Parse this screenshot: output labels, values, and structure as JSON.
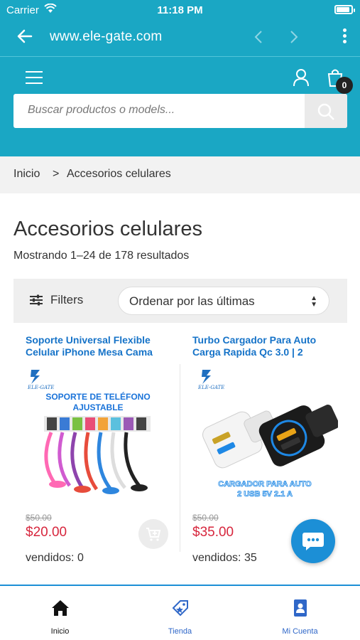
{
  "status_bar": {
    "carrier": "Carrier",
    "time": "11:18 PM"
  },
  "browser": {
    "url": "www.ele-gate.com"
  },
  "header": {
    "cart_count": "0",
    "search_placeholder": "Buscar productos o models..."
  },
  "breadcrumb": {
    "home": "Inicio",
    "separator": ">",
    "current": "Accesorios celulares"
  },
  "page": {
    "title": "Accesorios celulares",
    "result_count": "Mostrando 1–24 de 178 resultados"
  },
  "toolbar": {
    "filters_label": "Filters",
    "sort_value": "Ordenar por las últimas"
  },
  "products": [
    {
      "title": "Soporte Universal Flexible Celular iPhone Mesa Cama",
      "image_brand": "ELE-GATE",
      "image_caption": "SOPORTE DE TELÉFONO AJUSTABLE",
      "old_price": "$50.00",
      "price": "$20.00",
      "sold": "vendidos: 0"
    },
    {
      "title": "Turbo Cargador Para Auto Carga Rapida Qc 3.0 | 2",
      "image_brand": "ELE-GATE",
      "image_caption": "CARGADOR PARA AUTO 2 USB 5V 2.1 A",
      "old_price": "$50.00",
      "price": "$35.00",
      "sold": "vendidos: 35"
    }
  ],
  "tabbar": {
    "home": "Inicio",
    "shop": "Tienda",
    "account": "Mi Cuenta"
  },
  "colors": {
    "brand": "#1aa7c4",
    "link": "#1673c8",
    "price": "#d7263d",
    "chat": "#1c8fd6"
  }
}
